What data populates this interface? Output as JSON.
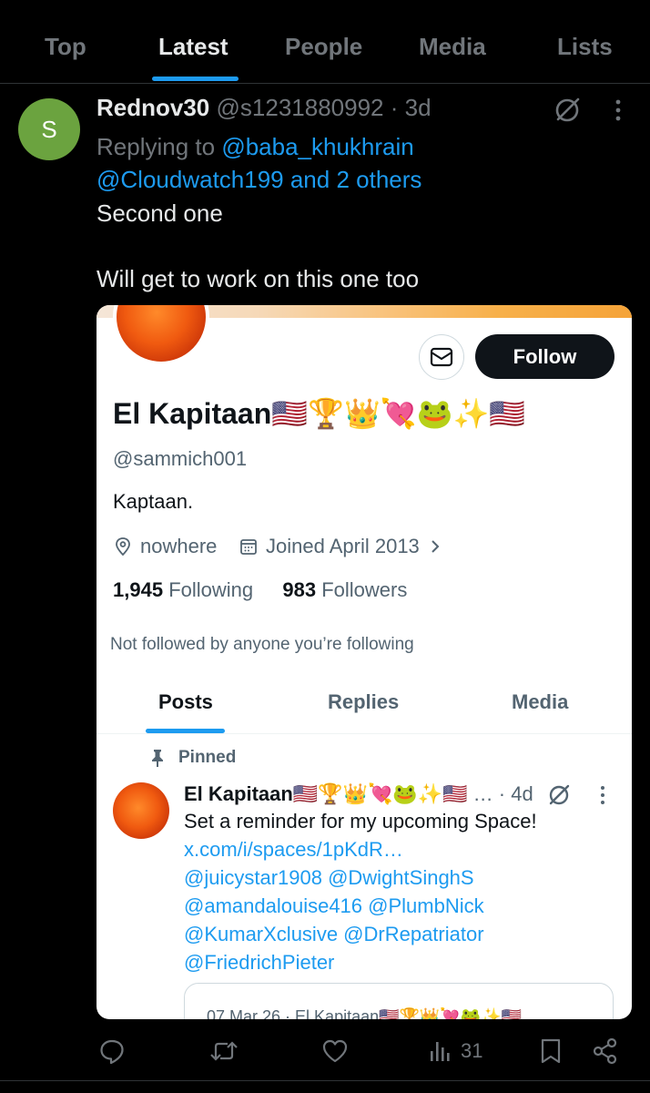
{
  "tabs": [
    {
      "label": "Top"
    },
    {
      "label": "Latest"
    },
    {
      "label": "People"
    },
    {
      "label": "Media"
    },
    {
      "label": "Lists"
    }
  ],
  "active_tab": "Latest",
  "tweet": {
    "avatar_letter": "S",
    "avatar_color": "#6ba33f",
    "display_name": "Rednov30",
    "handle": "@s1231880992",
    "time": "· 3d",
    "replying_prefix": "Replying to ",
    "replying_mention_1": "@baba_khukhrain",
    "replying_mention_2": "@Cloudwatch199 and 2 others",
    "text_line_1": "Second one",
    "text_line_2": "Will get to work on this one too"
  },
  "card": {
    "follow_label": "Follow",
    "name": "El Kapitaan🇺🇸🏆👑💘🐸✨🇺🇸",
    "handle": "@sammich001",
    "bio": "Kaptaan.",
    "location": "nowhere",
    "joined": "Joined April 2013",
    "following_count": "1,945",
    "following_label": "Following",
    "followers_count": "983",
    "followers_label": "Followers",
    "not_followed": "Not followed by anyone you’re following",
    "tabs": [
      {
        "label": "Posts"
      },
      {
        "label": "Replies"
      },
      {
        "label": "Media"
      }
    ],
    "active_tab": "Posts",
    "pinned_label": "Pinned",
    "post": {
      "name": "El Kapitaan🇺🇸🏆👑💘🐸✨🇺🇸",
      "ellipsis": " …",
      "time": " · 4d",
      "line_1": "Set a reminder for my upcoming Space!",
      "link": "x.com/i/spaces/1pKdR…",
      "mentions_1": "@juicystar1908 @DwightSinghS",
      "mentions_2": "@amandalouise416 @PlumbNick",
      "mentions_3": "@KumarXclusive @DrRepatriator",
      "mentions_4": "@FriedrichPieter",
      "quote_preview": "07 Mar 26 · El Kapitaan🇺🇸🏆👑💘🐸✨🇺🇸"
    }
  },
  "actions": {
    "views_count": "31"
  },
  "icons": {
    "reply": "reply-icon",
    "repost": "repost-icon",
    "like": "heart-icon",
    "views": "views-icon",
    "bookmark": "bookmark-icon",
    "share": "share-icon"
  },
  "colors": {
    "accent": "#1d9bf0",
    "background": "#000000",
    "muted": "#71767b"
  }
}
